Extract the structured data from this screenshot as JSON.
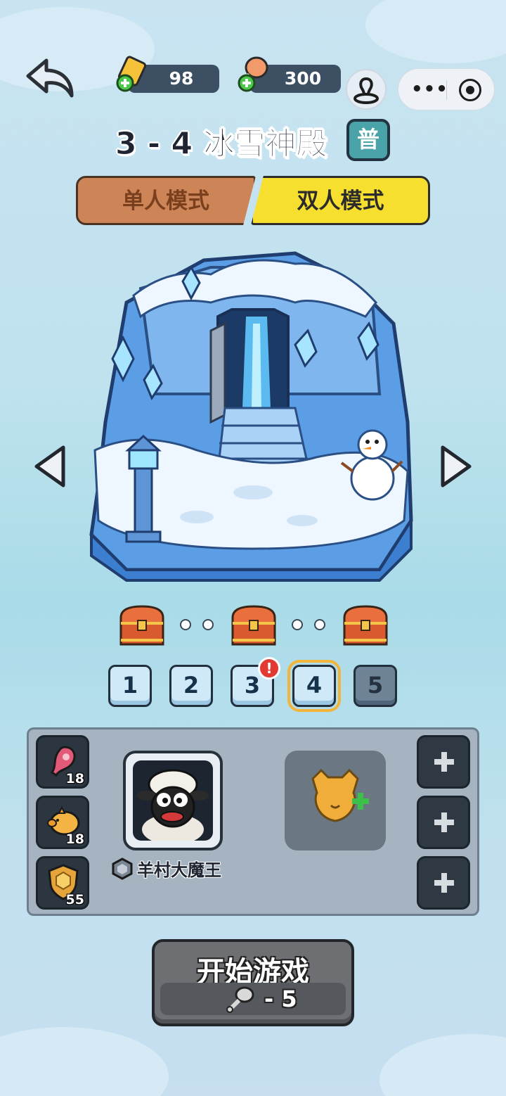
{
  "resources": {
    "gold": "98",
    "stamina": "300"
  },
  "level": {
    "title": "3 - 4 冰雪神殿",
    "difficulty": "普"
  },
  "modes": {
    "single": "单人模式",
    "double": "双人模式",
    "selected": "double"
  },
  "stages": [
    {
      "label": "1",
      "state": "cleared"
    },
    {
      "label": "2",
      "state": "cleared"
    },
    {
      "label": "3",
      "state": "cleared",
      "alert": "!"
    },
    {
      "label": "4",
      "state": "selected"
    },
    {
      "label": "5",
      "state": "locked"
    }
  ],
  "buffs": [
    {
      "icon": "meat-buff-icon",
      "count": "18"
    },
    {
      "icon": "piggy-bank-icon",
      "count": "18"
    },
    {
      "icon": "shield-icon",
      "count": "55"
    }
  ],
  "team": {
    "hero_name": "羊村大魔王",
    "partner_slot_icon": "add-partner-icon"
  },
  "start": {
    "label": "开始游戏",
    "cost": "- 5"
  },
  "colors": {
    "accent_yellow": "#f6df2e",
    "tab_brown": "#cd8558",
    "badge_teal": "#4aa3a8"
  }
}
